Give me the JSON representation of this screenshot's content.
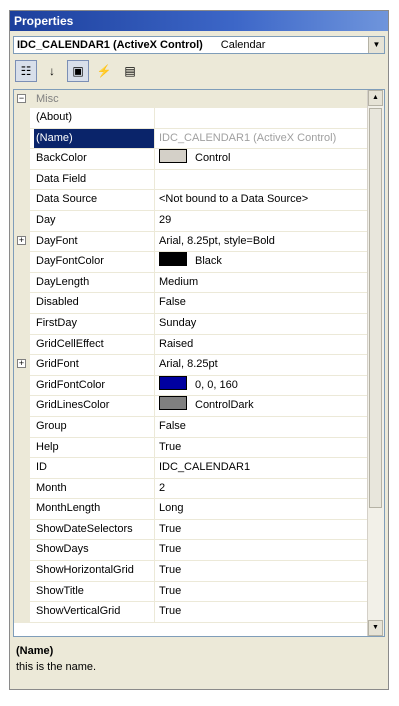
{
  "window": {
    "title": "Properties"
  },
  "object_selector": {
    "name": "IDC_CALENDAR1 (ActiveX Control)",
    "class": "Calendar",
    "dropdown_icon": "chevron-down-icon"
  },
  "toolbar": {
    "buttons": [
      {
        "icon": "categorized-icon",
        "glyph": "☷",
        "active": true
      },
      {
        "icon": "alphabetical-icon",
        "glyph": "↓",
        "active": false
      },
      {
        "icon": "properties-icon",
        "glyph": "▣",
        "active": true
      },
      {
        "icon": "events-icon",
        "glyph": "⚡",
        "active": false
      },
      {
        "icon": "property-pages-icon",
        "glyph": "▤",
        "active": false
      }
    ]
  },
  "grid": {
    "category": "Misc",
    "rows": [
      {
        "name": "(About)",
        "value": "",
        "selected": false,
        "dim": false,
        "expander": false,
        "swatch": ""
      },
      {
        "name": "(Name)",
        "value": "IDC_CALENDAR1 (ActiveX Control)",
        "selected": true,
        "dim": true,
        "expander": false,
        "swatch": ""
      },
      {
        "name": "BackColor",
        "value": "Control",
        "selected": false,
        "dim": false,
        "expander": false,
        "swatch": "#d4d0c8"
      },
      {
        "name": "Data Field",
        "value": "",
        "selected": false,
        "dim": false,
        "expander": false,
        "swatch": ""
      },
      {
        "name": "Data Source",
        "value": "<Not bound to a Data Source>",
        "selected": false,
        "dim": false,
        "expander": false,
        "swatch": ""
      },
      {
        "name": "Day",
        "value": "29",
        "selected": false,
        "dim": false,
        "expander": false,
        "swatch": ""
      },
      {
        "name": "DayFont",
        "value": "Arial, 8.25pt, style=Bold",
        "selected": false,
        "dim": false,
        "expander": true,
        "swatch": ""
      },
      {
        "name": "DayFontColor",
        "value": "Black",
        "selected": false,
        "dim": false,
        "expander": false,
        "swatch": "#000000"
      },
      {
        "name": "DayLength",
        "value": "Medium",
        "selected": false,
        "dim": false,
        "expander": false,
        "swatch": ""
      },
      {
        "name": "Disabled",
        "value": "False",
        "selected": false,
        "dim": false,
        "expander": false,
        "swatch": ""
      },
      {
        "name": "FirstDay",
        "value": "Sunday",
        "selected": false,
        "dim": false,
        "expander": false,
        "swatch": ""
      },
      {
        "name": "GridCellEffect",
        "value": "Raised",
        "selected": false,
        "dim": false,
        "expander": false,
        "swatch": ""
      },
      {
        "name": "GridFont",
        "value": "Arial, 8.25pt",
        "selected": false,
        "dim": false,
        "expander": true,
        "swatch": ""
      },
      {
        "name": "GridFontColor",
        "value": "0, 0, 160",
        "selected": false,
        "dim": false,
        "expander": false,
        "swatch": "#0000a0"
      },
      {
        "name": "GridLinesColor",
        "value": "ControlDark",
        "selected": false,
        "dim": false,
        "expander": false,
        "swatch": "#808080"
      },
      {
        "name": "Group",
        "value": "False",
        "selected": false,
        "dim": false,
        "expander": false,
        "swatch": ""
      },
      {
        "name": "Help",
        "value": "True",
        "selected": false,
        "dim": false,
        "expander": false,
        "swatch": ""
      },
      {
        "name": "ID",
        "value": "IDC_CALENDAR1",
        "selected": false,
        "dim": false,
        "expander": false,
        "swatch": ""
      },
      {
        "name": "Month",
        "value": "2",
        "selected": false,
        "dim": false,
        "expander": false,
        "swatch": ""
      },
      {
        "name": "MonthLength",
        "value": "Long",
        "selected": false,
        "dim": false,
        "expander": false,
        "swatch": ""
      },
      {
        "name": "ShowDateSelectors",
        "value": "True",
        "selected": false,
        "dim": false,
        "expander": false,
        "swatch": ""
      },
      {
        "name": "ShowDays",
        "value": "True",
        "selected": false,
        "dim": false,
        "expander": false,
        "swatch": ""
      },
      {
        "name": "ShowHorizontalGrid",
        "value": "True",
        "selected": false,
        "dim": false,
        "expander": false,
        "swatch": ""
      },
      {
        "name": "ShowTitle",
        "value": "True",
        "selected": false,
        "dim": false,
        "expander": false,
        "swatch": ""
      },
      {
        "name": "ShowVerticalGrid",
        "value": "True",
        "selected": false,
        "dim": false,
        "expander": false,
        "swatch": ""
      }
    ]
  },
  "description": {
    "title": "(Name)",
    "text": "this is the name."
  },
  "colors": {
    "selection": "#0a246a",
    "titlebar": "#1c3f9c"
  }
}
